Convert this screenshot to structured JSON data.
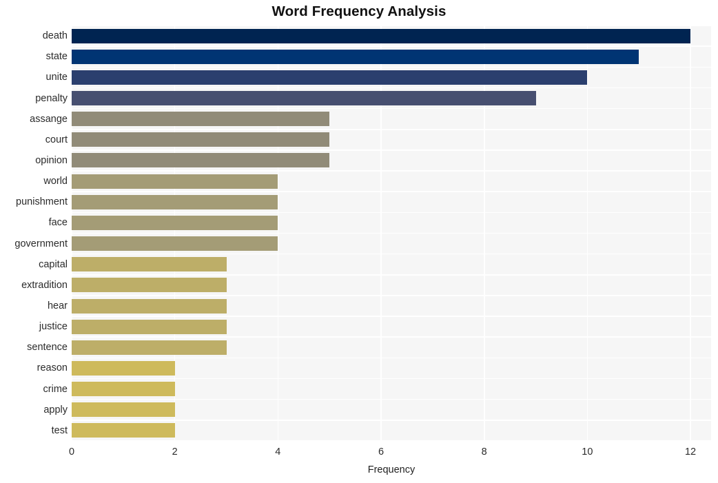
{
  "chart_data": {
    "type": "bar",
    "orientation": "horizontal",
    "title": "Word Frequency Analysis",
    "xlabel": "Frequency",
    "ylabel": "",
    "xlim": [
      0,
      12.4
    ],
    "xticks": [
      0,
      2,
      4,
      6,
      8,
      10,
      12
    ],
    "xtick_labels": [
      "0",
      "2",
      "4",
      "6",
      "8",
      "10",
      "12"
    ],
    "grid": true,
    "grid_color": "#ffffff",
    "plot_background": "#f6f6f6",
    "figure_background": "#ffffff",
    "legend": null,
    "categories": [
      "death",
      "state",
      "unite",
      "penalty",
      "assange",
      "court",
      "opinion",
      "world",
      "punishment",
      "face",
      "government",
      "capital",
      "extradition",
      "hear",
      "justice",
      "sentence",
      "reason",
      "crime",
      "apply",
      "test"
    ],
    "values": [
      12,
      11,
      10,
      9,
      5,
      5,
      5,
      4,
      4,
      4,
      4,
      3,
      3,
      3,
      3,
      3,
      2,
      2,
      2,
      2
    ],
    "bar_colors": [
      "#002451",
      "#003473",
      "#2b3f६e",
      "#474f70",
      "#918b78",
      "#918b78",
      "#918b78",
      "#a49c76",
      "#a49c76",
      "#a49c76",
      "#a49c76",
      "#bdae68",
      "#bdae68",
      "#bdae68",
      "#bdae68",
      "#bdae68",
      "#ceba5c",
      "#ceba5c",
      "#ceba5c",
      "#ceba5c"
    ],
    "bars": [
      {
        "label": "death",
        "value": 12,
        "color": "#002451"
      },
      {
        "label": "state",
        "value": 11,
        "color": "#003473"
      },
      {
        "label": "unite",
        "value": 10,
        "color": "#2b3f6e"
      },
      {
        "label": "penalty",
        "value": 9,
        "color": "#474f70"
      },
      {
        "label": "assange",
        "value": 5,
        "color": "#918b78"
      },
      {
        "label": "court",
        "value": 5,
        "color": "#918b78"
      },
      {
        "label": "opinion",
        "value": 5,
        "color": "#918b78"
      },
      {
        "label": "world",
        "value": 4,
        "color": "#a49c76"
      },
      {
        "label": "punishment",
        "value": 4,
        "color": "#a49c76"
      },
      {
        "label": "face",
        "value": 4,
        "color": "#a49c76"
      },
      {
        "label": "government",
        "value": 4,
        "color": "#a49c76"
      },
      {
        "label": "capital",
        "value": 3,
        "color": "#bdae68"
      },
      {
        "label": "extradition",
        "value": 3,
        "color": "#bdae68"
      },
      {
        "label": "hear",
        "value": 3,
        "color": "#bdae68"
      },
      {
        "label": "justice",
        "value": 3,
        "color": "#bdae68"
      },
      {
        "label": "sentence",
        "value": 3,
        "color": "#bdae68"
      },
      {
        "label": "reason",
        "value": 2,
        "color": "#ceba5c"
      },
      {
        "label": "crime",
        "value": 2,
        "color": "#ceba5c"
      },
      {
        "label": "apply",
        "value": 2,
        "color": "#ceba5c"
      },
      {
        "label": "test",
        "value": 2,
        "color": "#ceba5c"
      }
    ]
  }
}
